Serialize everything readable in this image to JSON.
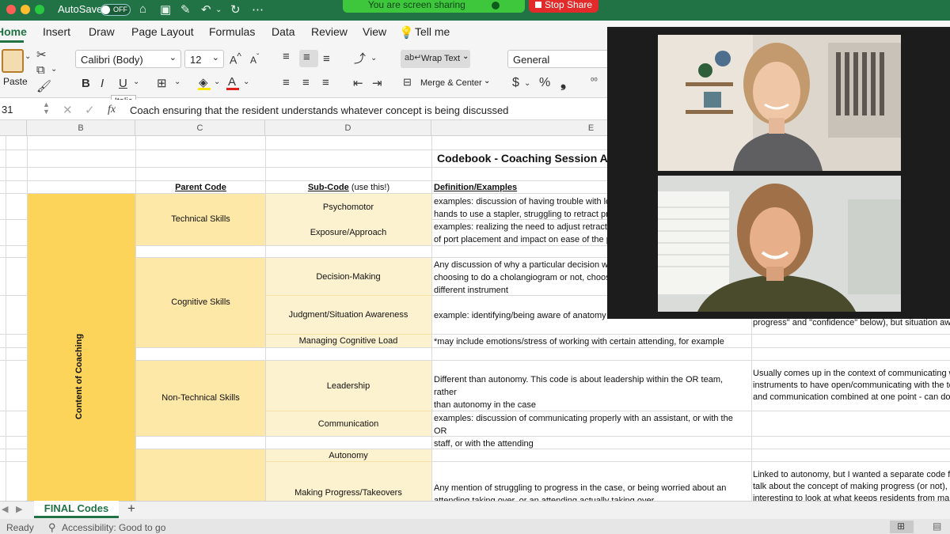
{
  "titlebar": {
    "autosave_label": "AutoSave",
    "autosave_state": "OFF",
    "sharing_text": "You are screen sharing",
    "stop_share_label": "Stop Share"
  },
  "ribbon_tabs": [
    "Home",
    "Insert",
    "Draw",
    "Page Layout",
    "Formulas",
    "Data",
    "Review",
    "View"
  ],
  "tell_me": "Tell me",
  "ribbon": {
    "paste_label": "Paste",
    "font_name": "Calibri (Body)",
    "font_size": "12",
    "bold": "B",
    "italic": "I",
    "underline": "U",
    "italic_tooltip": "Italic",
    "wrap_text": "Wrap Text",
    "merge_center": "Merge & Center",
    "number_format": "General",
    "currency": "$",
    "percent": "%",
    "comma": "❟"
  },
  "formula_bar": {
    "name_box": "31",
    "fx": "fx",
    "content": "Coach ensuring that the resident understands whatever concept is being discussed"
  },
  "columns": [
    "B",
    "C",
    "D",
    "E"
  ],
  "sheet": {
    "title": "Codebook - Coaching Session Ana",
    "header_parent": "Parent Code",
    "header_sub": "Sub-Code",
    "header_sub_suffix": " (use this!)",
    "header_def": "Definition/Examples",
    "category": "Content of Coaching",
    "parents": [
      "Technical Skills",
      "Cognitive Skills",
      "Non-Technical Skills"
    ],
    "subcodes": [
      "Psychomotor",
      "Exposure/Approach",
      "Decision-Making",
      "Judgment/Situation Awareness",
      "Managing Cognitive Load",
      "Leadership",
      "Communication",
      "Autonomy",
      "Making Progress/Takeovers"
    ],
    "definitions": {
      "psychomotor": [
        "examples: discussion of having trouble with los",
        "hands to use a stapler, struggling to retract pro"
      ],
      "exposure": [
        "examples: realizing the need to adjust retractio",
        "of port placement and impact on ease of the p"
      ],
      "decision": [
        "Any discussion of why a particular decision was",
        "choosing to do a cholangiogram or not, choosin",
        "different instrument"
      ],
      "judgment": "example: identifying/being aware of anatomy",
      "cognitive_load": "*may include emotions/stress of working with certain attending, for example",
      "leadership": [
        "Different than autonomy. This code is about leadership within the OR team, rather",
        "than autonomy in the case"
      ],
      "communication": [
        "examples: discussion of communicating properly with an assistant, or with the OR",
        "staff, or with the attending"
      ],
      "progress": [
        "Any mention of struggling to progress in the case, or being worried about an",
        "attending taking over, or an attending actually taking over"
      ]
    },
    "notes": {
      "judgment": "progress\" and \"confidence\" below), but situation awa",
      "leadership": [
        "Usually comes up in the context of communicating w",
        "instruments to have open/communicating with the te",
        "and communication combined at one point - can do t"
      ],
      "progress": [
        "Linked to autonomy, but I wanted a separate code fo",
        "talk about the concept of making progress (or not), b",
        "interesting to look at what keeps residents from mak"
      ]
    }
  },
  "sheet_tab": "FINAL Codes",
  "status": {
    "ready": "Ready",
    "accessibility": "Accessibility: Good to go"
  },
  "colors": {
    "excel_green": "#217346",
    "category_fill": "#fcd45a",
    "parent_fill": "#fde8a8",
    "sub_fill": "#fdf2d0"
  }
}
